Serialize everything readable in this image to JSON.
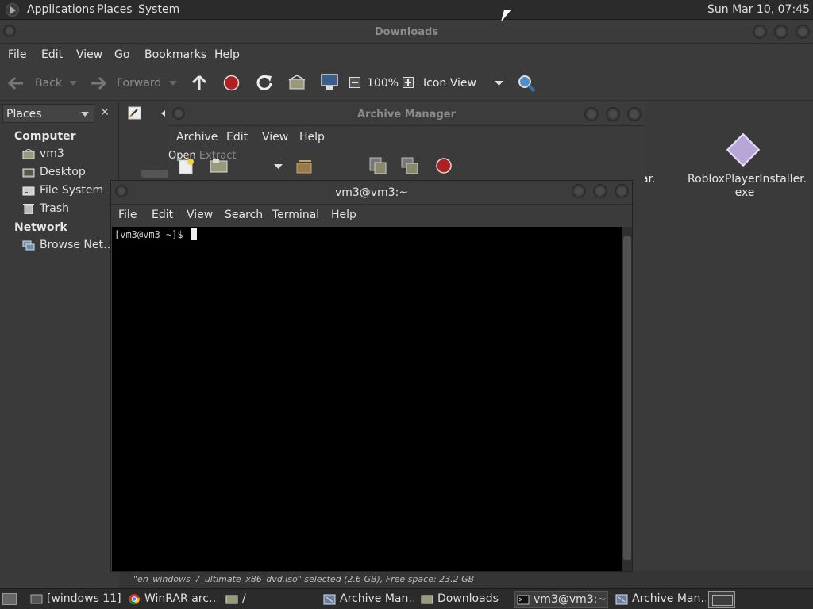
{
  "top_panel": {
    "menus": [
      "Applications",
      "Places",
      "System"
    ],
    "clock": "Sun Mar 10, 07:45"
  },
  "file_manager": {
    "title": "Downloads",
    "menu": [
      "File",
      "Edit",
      "View",
      "Go",
      "Bookmarks",
      "Help"
    ],
    "toolbar": {
      "back": "Back",
      "forward": "Forward",
      "zoom": "100%",
      "view_mode": "Icon View"
    },
    "sidebar": {
      "selector": "Places",
      "computer_header": "Computer",
      "computer_items": [
        "vm3",
        "Desktop",
        "File System",
        "Trash"
      ],
      "network_header": "Network",
      "network_items": [
        "Browse Net…"
      ]
    },
    "files": [
      {
        "name_line1": "RobloxPlayerInstaller.",
        "name_line2": "exe"
      }
    ],
    "partial_file_name": "ar.",
    "status": "\"en_windows_7_ultimate_x86_dvd.iso\" selected (2.6 GB), Free space: 23.2 GB"
  },
  "archive_manager": {
    "title": "Archive Manager",
    "menu": [
      "Archive",
      "Edit",
      "View",
      "Help"
    ],
    "toolbar": {
      "open": "Open",
      "extract": "Extract"
    }
  },
  "terminal": {
    "title": "vm3@vm3:~",
    "menu": [
      "File",
      "Edit",
      "View",
      "Search",
      "Terminal",
      "Help"
    ],
    "prompt": "[vm3@vm3 ~]$ "
  },
  "taskbar": {
    "items": [
      {
        "label": "[windows 11]",
        "icon": "window-icon"
      },
      {
        "label": "WinRAR arc…",
        "icon": "chrome-icon"
      },
      {
        "label": "/",
        "icon": "folder-icon"
      },
      {
        "label": "Archive Man…",
        "icon": "archive-icon"
      },
      {
        "label": "Downloads",
        "icon": "folder-icon"
      },
      {
        "label": "vm3@vm3:~",
        "icon": "terminal-icon"
      },
      {
        "label": "Archive Man…",
        "icon": "archive-icon"
      }
    ]
  }
}
